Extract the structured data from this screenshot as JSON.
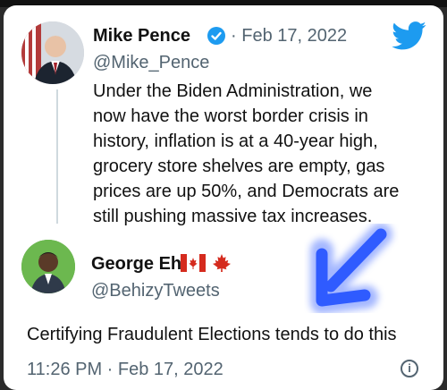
{
  "tweet": {
    "author_name": "Mike Pence",
    "date_sep": "·",
    "date": "Feb 17, 2022",
    "handle": "@Mike_Pence",
    "text_lines": [
      "Under the Biden Administration, we",
      "now have the worst border crisis in",
      "history, inflation is at a 40-year high,",
      "grocery store shelves are empty, gas",
      "prices are up 50%, and Democrats are",
      "still pushing massive tax increases."
    ]
  },
  "reply": {
    "author_name": "George Eh",
    "handle": "@BehizyTweets",
    "text": "Certifying Fraudulent Elections tends to do this",
    "timestamp": "11:26 PM · Feb 17, 2022"
  },
  "icons": {
    "verified": "verified-badge-icon",
    "twitter": "twitter-bird-icon",
    "canada_flag": "canada-flag-icon",
    "maple_leaf": "maple-leaf-icon",
    "arrow": "blue-arrow-icon",
    "info": "info-icon"
  },
  "colors": {
    "twitter_blue": "#1d9bf0",
    "arrow_blue": "#2f5bff"
  }
}
